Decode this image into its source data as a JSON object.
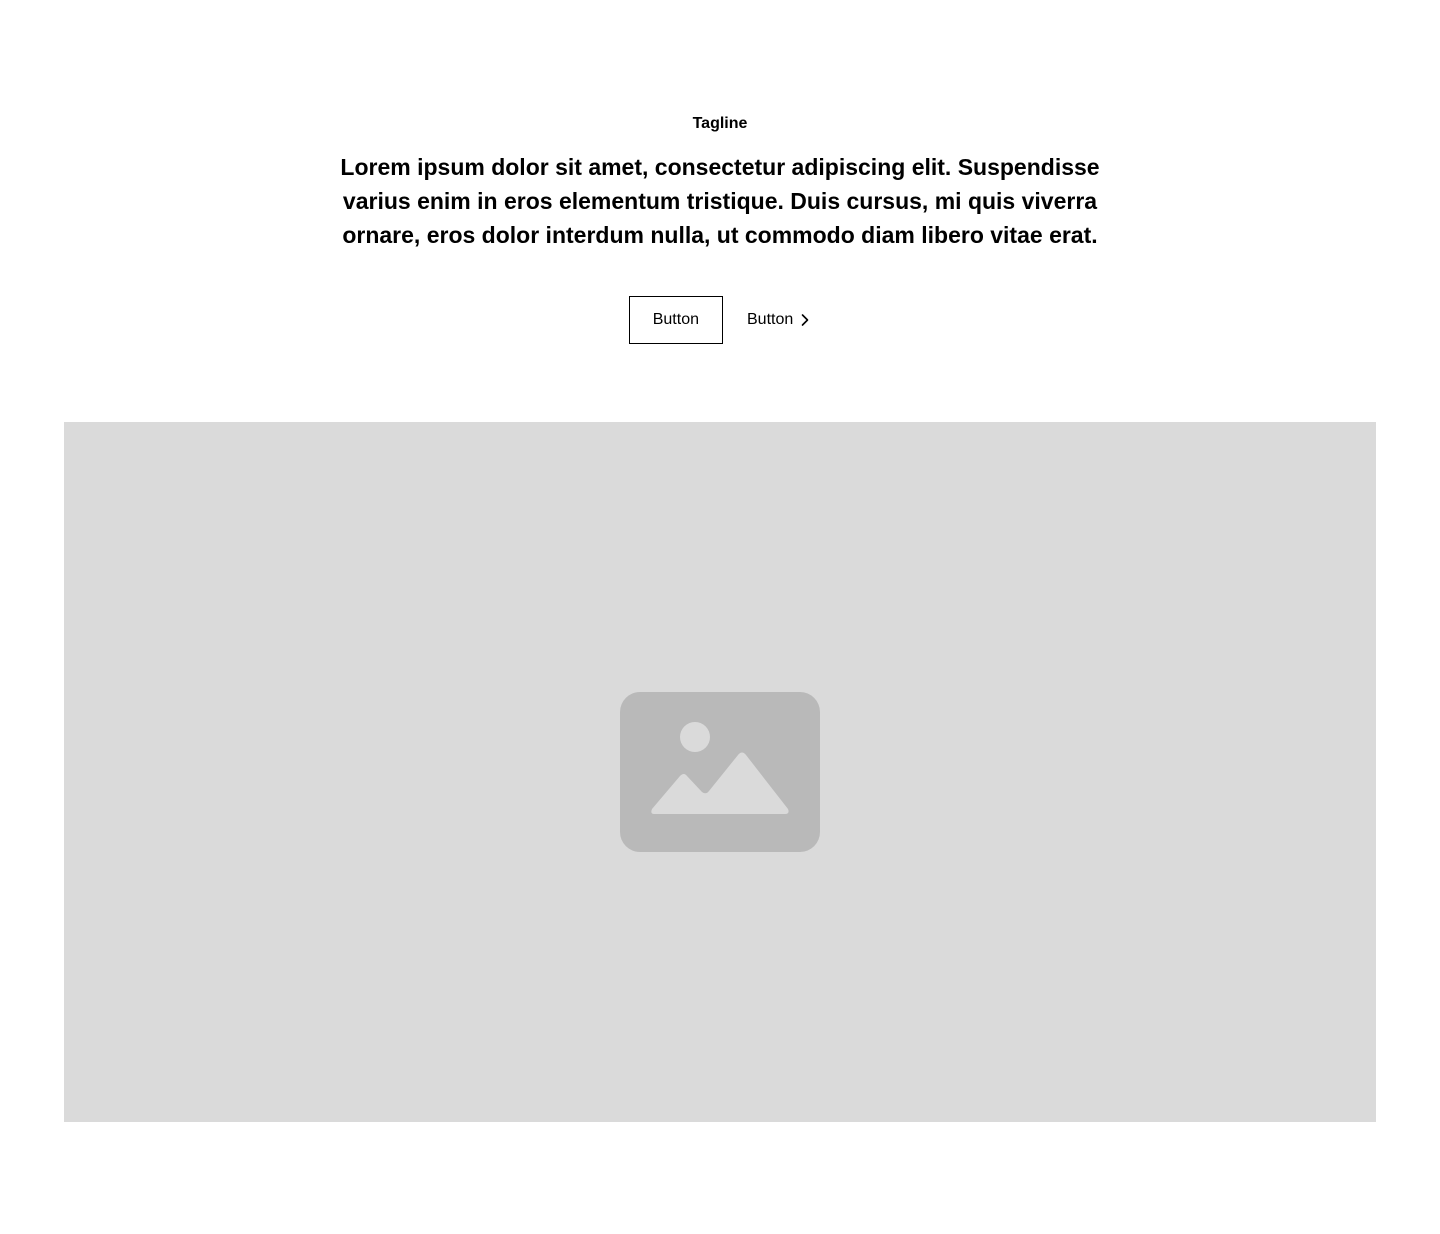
{
  "hero": {
    "tagline": "Tagline",
    "headline": "Lorem ipsum dolor sit amet, consectetur adipiscing elit. Suspendisse varius enim in eros elementum tristique. Duis cursus, mi quis viverra ornare, eros dolor interdum nulla, ut commodo diam libero vitae erat.",
    "primary_button_label": "Button",
    "secondary_button_label": "Button",
    "secondary_button_icon": "chevron-right-icon"
  },
  "media": {
    "placeholder_icon": "image-placeholder-icon",
    "background_color": "#dadada",
    "icon_color": "#b9b9b9"
  }
}
